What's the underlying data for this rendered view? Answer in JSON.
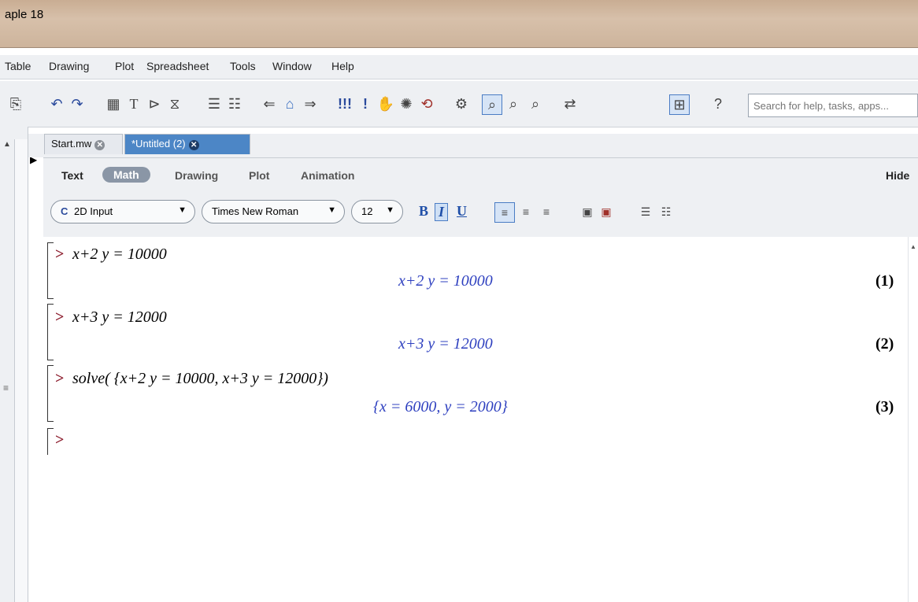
{
  "window": {
    "title": "aple 18"
  },
  "menu": [
    {
      "label": "Table"
    },
    {
      "label": "Drawing"
    },
    {
      "label": "Plot"
    },
    {
      "label": "Spreadsheet"
    },
    {
      "label": "Tools"
    },
    {
      "label": "Window"
    },
    {
      "label": "Help"
    }
  ],
  "toolbar": {
    "search_placeholder": "Search for help, tasks, apps...",
    "icons": [
      "paste-icon",
      "undo-icon",
      "redo-icon",
      "math-text-icon",
      "text-icon",
      "execution-group-icon",
      "section-icon",
      "indent-icon",
      "outdent-icon",
      "back-icon",
      "home-icon",
      "forward-icon",
      "execute-all-icon",
      "execute-icon",
      "stop-icon",
      "debug-icon",
      "restart-icon",
      "settings-icon",
      "zoom-100-icon",
      "zoom-150-icon",
      "zoom-200-icon",
      "toggle-icon",
      "insert-math-icon",
      "help-icon"
    ]
  },
  "tabs": [
    {
      "label": "Start.mw"
    },
    {
      "label": "*Untitled (2)"
    }
  ],
  "context": {
    "modes": [
      "Text",
      "Math",
      "Drawing",
      "Plot",
      "Animation"
    ],
    "hide_label": "Hide",
    "input_mode": "2D Input",
    "input_mode_icon": "C",
    "font": "Times New Roman",
    "size": "12",
    "bold": "B",
    "italic": "I",
    "underline": "U"
  },
  "worksheet": {
    "prompt": ">",
    "groups": [
      {
        "input": "x+2 y = 10000",
        "output": "x+2 y = 10000",
        "label": "(1)"
      },
      {
        "input": "x+3 y = 12000",
        "output": "x+3 y = 12000",
        "label": "(2)"
      },
      {
        "input": "solve( {x+2 y = 10000, x+3 y = 12000})",
        "output": "{x = 6000, y = 2000}",
        "label": "(3)"
      }
    ]
  },
  "colors": {
    "prompt": "#8b1a2b",
    "output": "#2d3fbf",
    "active_tab": "#4c86c6"
  }
}
